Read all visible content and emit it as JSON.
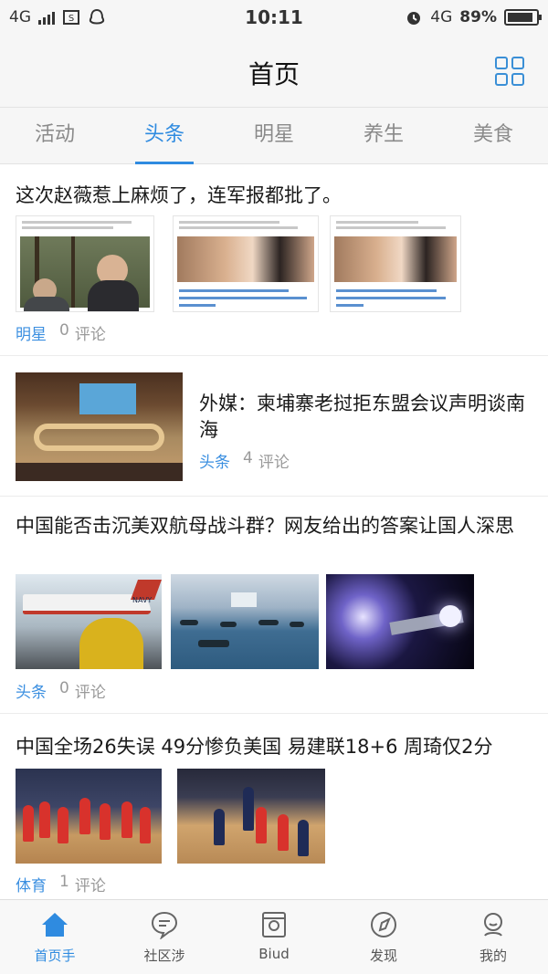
{
  "status_bar": {
    "network_left": "4G",
    "time": "10:11",
    "network_right": "4G",
    "battery": "89%",
    "battery_level": 0.89
  },
  "header": {
    "title": "首页",
    "grid_icon": "grid-icon"
  },
  "tabs": [
    {
      "label": "活动",
      "active": false
    },
    {
      "label": "头条",
      "active": true
    },
    {
      "label": "明星",
      "active": false
    },
    {
      "label": "养生",
      "active": false
    },
    {
      "label": "美食",
      "active": false
    }
  ],
  "articles": [
    {
      "title": "这次赵薇惹上麻烦了，连军报都批了。",
      "tag": "明星",
      "comment_count": "0",
      "comment_label": "评论",
      "thumb_captions": [
        "",
        "赵薇、戴立忍及电影《没有别的爱》遭网友警告请反对",
        "赵薇、戴立忍及电影《没有别的爱》遭网友警告请反对"
      ]
    },
    {
      "title": "外媒：柬埔寨老挝拒东盟会议声明谈南海",
      "tag": "头条",
      "comment_count": "4",
      "comment_label": "评论"
    },
    {
      "title": "中国能否击沉美双航母战斗群？网友给出的答案让国人深思",
      "tag": "头条",
      "comment_count": "0",
      "comment_label": "评论",
      "thumb_captions": [
        "NAVY",
        "",
        ""
      ]
    },
    {
      "title": "中国全场26失误 49分惨负美国 易建联18+6 周琦仅2分",
      "tag": "体育",
      "comment_count": "1",
      "comment_label": "评论"
    }
  ],
  "bottom_nav": [
    {
      "label": "首页手",
      "icon": "home-icon",
      "active": true
    },
    {
      "label": "社区涉",
      "icon": "chat-bubble-icon",
      "active": false
    },
    {
      "label": "Biud",
      "icon": "camera-icon",
      "active": false
    },
    {
      "label": "发现",
      "icon": "compass-icon",
      "active": false
    },
    {
      "label": "我的",
      "icon": "user-icon",
      "active": false
    }
  ],
  "colors": {
    "accent": "#2f8be0",
    "tag": "#3b8fe0",
    "muted": "#9a9a9a"
  }
}
